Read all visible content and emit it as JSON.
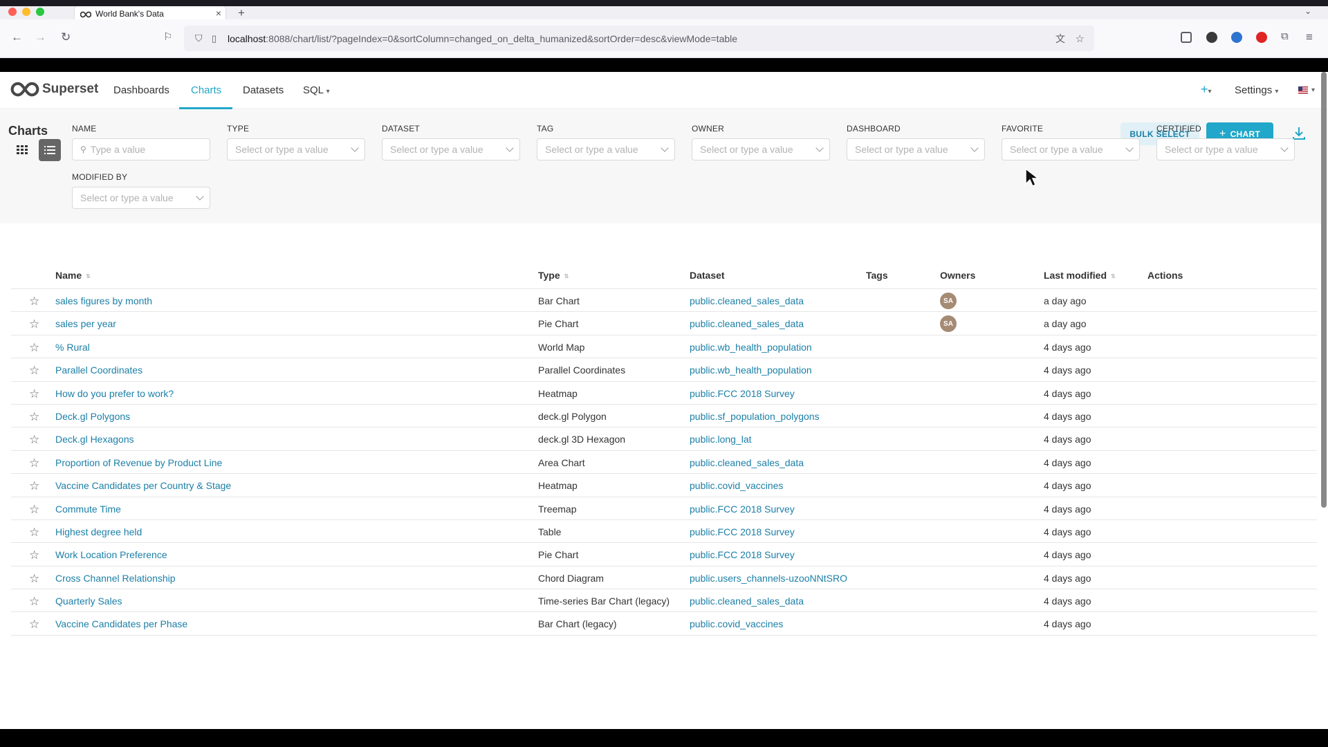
{
  "browser": {
    "tab_title": "World Bank's Data",
    "url_host": "localhost",
    "url_rest": ":8088/chart/list/?pageIndex=0&sortColumn=changed_on_delta_humanized&sortOrder=desc&viewMode=table",
    "new_tab": "+",
    "close": "×"
  },
  "header": {
    "brand": "Superset",
    "menu": [
      "Dashboards",
      "Charts",
      "Datasets",
      "SQL"
    ],
    "sql_caret": "▾",
    "plus": "+",
    "plus_caret": "▾",
    "settings": "Settings",
    "settings_caret": "▾",
    "accent": "#20a7c9"
  },
  "subheader": {
    "title": "Charts",
    "bulk_select": "BULK SELECT",
    "add_chart": "CHART",
    "add_plus": "+"
  },
  "filters": [
    {
      "label": "NAME",
      "placeholder": "Type a value",
      "search": true
    },
    {
      "label": "TYPE",
      "placeholder": "Select or type a value"
    },
    {
      "label": "DATASET",
      "placeholder": "Select or type a value"
    },
    {
      "label": "TAG",
      "placeholder": "Select or type a value"
    },
    {
      "label": "OWNER",
      "placeholder": "Select or type a value"
    },
    {
      "label": "DASHBOARD",
      "placeholder": "Select or type a value"
    },
    {
      "label": "FAVORITE",
      "placeholder": "Select or type a value"
    },
    {
      "label": "CERTIFIED",
      "placeholder": "Select or type a value"
    },
    {
      "label": "MODIFIED BY",
      "placeholder": "Select or type a value"
    }
  ],
  "table": {
    "columns": [
      "Name",
      "Type",
      "Dataset",
      "Tags",
      "Owners",
      "Last modified",
      "Actions"
    ],
    "rows": [
      {
        "name": "sales figures by month",
        "type": "Bar Chart",
        "dataset": "public.cleaned_sales_data",
        "owner": "SA",
        "modified": "a day ago"
      },
      {
        "name": "sales per year",
        "type": "Pie Chart",
        "dataset": "public.cleaned_sales_data",
        "owner": "SA",
        "modified": "a day ago"
      },
      {
        "name": "% Rural",
        "type": "World Map",
        "dataset": "public.wb_health_population",
        "owner": "",
        "modified": "4 days ago"
      },
      {
        "name": "Parallel Coordinates",
        "type": "Parallel Coordinates",
        "dataset": "public.wb_health_population",
        "owner": "",
        "modified": "4 days ago"
      },
      {
        "name": "How do you prefer to work?",
        "type": "Heatmap",
        "dataset": "public.FCC 2018 Survey",
        "owner": "",
        "modified": "4 days ago"
      },
      {
        "name": "Deck.gl Polygons",
        "type": "deck.gl Polygon",
        "dataset": "public.sf_population_polygons",
        "owner": "",
        "modified": "4 days ago"
      },
      {
        "name": "Deck.gl Hexagons",
        "type": "deck.gl 3D Hexagon",
        "dataset": "public.long_lat",
        "owner": "",
        "modified": "4 days ago"
      },
      {
        "name": "Proportion of Revenue by Product Line",
        "type": "Area Chart",
        "dataset": "public.cleaned_sales_data",
        "owner": "",
        "modified": "4 days ago"
      },
      {
        "name": "Vaccine Candidates per Country & Stage",
        "type": "Heatmap",
        "dataset": "public.covid_vaccines",
        "owner": "",
        "modified": "4 days ago"
      },
      {
        "name": "Commute Time",
        "type": "Treemap",
        "dataset": "public.FCC 2018 Survey",
        "owner": "",
        "modified": "4 days ago"
      },
      {
        "name": "Highest degree held",
        "type": "Table",
        "dataset": "public.FCC 2018 Survey",
        "owner": "",
        "modified": "4 days ago"
      },
      {
        "name": "Work Location Preference",
        "type": "Pie Chart",
        "dataset": "public.FCC 2018 Survey",
        "owner": "",
        "modified": "4 days ago"
      },
      {
        "name": "Cross Channel Relationship",
        "type": "Chord Diagram",
        "dataset": "public.users_channels-uzooNNtSRO",
        "owner": "",
        "modified": "4 days ago"
      },
      {
        "name": "Quarterly Sales",
        "type": "Time-series Bar Chart (legacy)",
        "dataset": "public.cleaned_sales_data",
        "owner": "",
        "modified": "4 days ago"
      },
      {
        "name": "Vaccine Candidates per Phase",
        "type": "Bar Chart (legacy)",
        "dataset": "public.covid_vaccines",
        "owner": "",
        "modified": "4 days ago"
      }
    ]
  }
}
